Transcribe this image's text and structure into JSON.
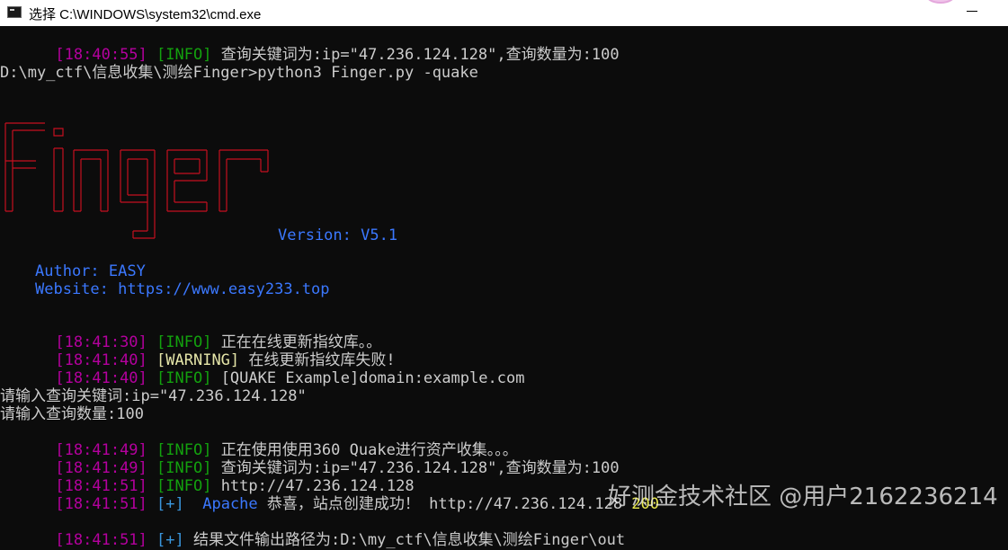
{
  "window": {
    "title": "选择 C:\\WINDOWS\\system32\\cmd.exe"
  },
  "console": {
    "line1": {
      "ts": "[18:40:55]",
      "level": "[INFO]",
      "msg": " 查询关键词为:ip=\"47.236.124.128\",查询数量为:100"
    },
    "prompt_line": "D:\\my_ctf\\信息收集\\测绘Finger>python3 Finger.py -quake",
    "version": "Version: V5.1",
    "author": "Author: EASY",
    "website": "Website: https://www.easy233.top",
    "log1": {
      "ts": "[18:41:30]",
      "level": "[INFO]",
      "msg": " 正在在线更新指纹库。。"
    },
    "log2": {
      "ts": "[18:41:40]",
      "level": "[WARNING]",
      "msg": " 在线更新指纹库失败!"
    },
    "log3": {
      "ts": "[18:41:40]",
      "level": "[INFO]",
      "msg": " [QUAKE Example]domain:example.com"
    },
    "input1": "请输入查询关键词:ip=\"47.236.124.128\"",
    "input2": "请输入查询数量:100",
    "log4": {
      "ts": "[18:41:49]",
      "level": "[INFO]",
      "msg": " 正在使用使用360 Quake进行资产收集。。。"
    },
    "log5": {
      "ts": "[18:41:49]",
      "level": "[INFO]",
      "msg": " 查询关键词为:ip=\"47.236.124.128\",查询数量为:100"
    },
    "log6": {
      "ts": "[18:41:51]",
      "level": "[INFO]",
      "msg": " http://47.236.124.128"
    },
    "log7": {
      "ts": "[18:41:51]",
      "level": "[+]",
      "server": "Apache",
      "msg": " 恭喜，站点创建成功！ http://47.236.124.128 ",
      "code": "200"
    },
    "log8": {
      "ts": "[18:41:51]",
      "level": "[+]",
      "msg": " 结果文件输出路径为:D:\\my_ctf\\信息收集\\测绘Finger\\out"
    }
  },
  "watermark": "好测金技术社区 @用户2162236214",
  "ascii_art_word": "Finger",
  "colors": {
    "background": "#0c0c0c",
    "timestamp": "#b4009e",
    "info": "#13a10e",
    "blue": "#3b78ff",
    "ascii_art": "#c50f1f",
    "status_code": "#e8e84f"
  }
}
